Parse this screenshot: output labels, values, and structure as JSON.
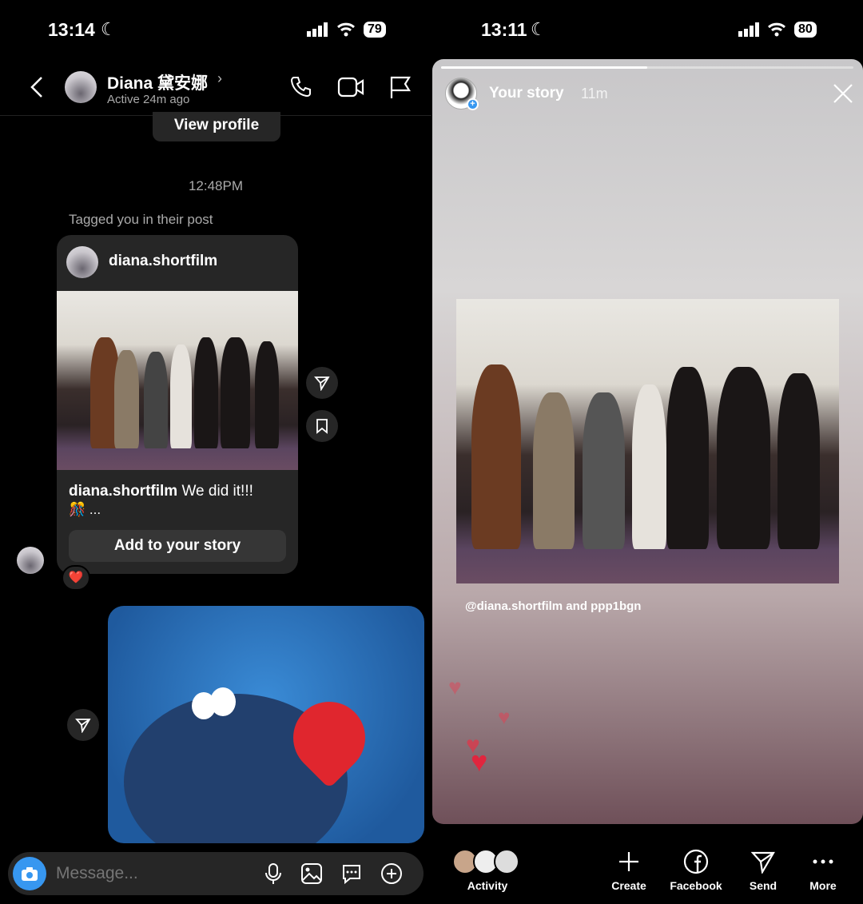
{
  "left": {
    "status": {
      "time": "13:14",
      "battery": "79"
    },
    "header": {
      "name": "Diana 黛安娜",
      "active": "Active 24m ago"
    },
    "view_profile": "View profile",
    "timestamp": "12:48PM",
    "tagged_label": "Tagged you in their post",
    "post": {
      "username": "diana.shortfilm",
      "caption_user": "diana.shortfilm",
      "caption_text": " We did it!!!",
      "caption_more": "🎊 ...",
      "add_story": "Add to your story",
      "reaction": "❤️"
    },
    "composer": {
      "placeholder": "Message..."
    }
  },
  "right": {
    "status": {
      "time": "13:11",
      "battery": "80"
    },
    "story": {
      "label": "Your story",
      "age": "11m",
      "progress": 0.5,
      "caption_user": "@diana.shortfilm",
      "caption_rest": " and ppp1bgn"
    },
    "bottom": {
      "activity": "Activity",
      "create": "Create",
      "facebook": "Facebook",
      "send": "Send",
      "more": "More"
    }
  },
  "colors": {
    "bubble": "#262626",
    "accent": "#3797f0",
    "sticker_bg": "#2f6fb6"
  }
}
